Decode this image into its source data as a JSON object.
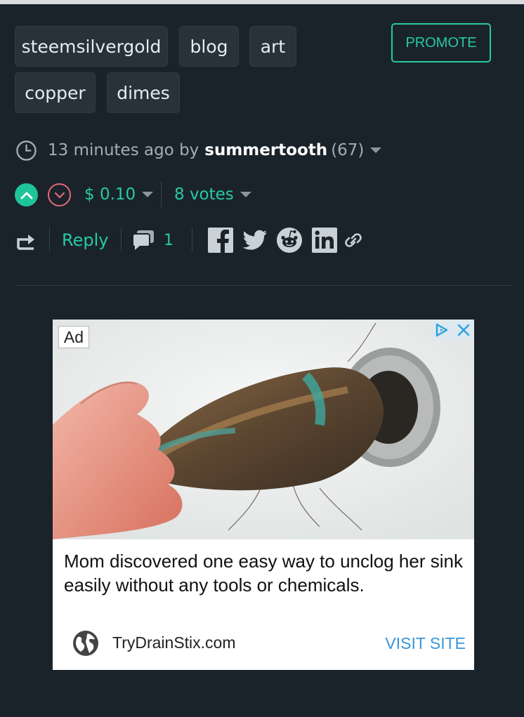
{
  "tags": [
    "steemsilvergold",
    "blog",
    "art",
    "copper",
    "dimes"
  ],
  "promote_label": "PROMOTE",
  "meta": {
    "time_ago": "13 minutes ago by",
    "author": "summertooth",
    "reputation": "(67)",
    "icon": "clock-icon"
  },
  "voting": {
    "payout": "$ 0.10",
    "votes": "8 votes",
    "upvote_icon": "upvote-icon",
    "downvote_icon": "downvote-icon",
    "upvote_color": "#1ec49a",
    "downvote_color": "#e0697a"
  },
  "actions": {
    "reply": "Reply",
    "comment_count": "1",
    "share_icons": [
      "facebook-icon",
      "twitter-icon",
      "reddit-icon",
      "linkedin-icon",
      "link-icon"
    ]
  },
  "ad": {
    "label": "Ad",
    "headline": "Mom discovered one easy way to unclog her sink easily without any tools or chemicals.",
    "domain": "TryDrainStix.com",
    "cta": "VISIT SITE",
    "cta_color": "#3a95da"
  },
  "colors": {
    "background": "#1b232a",
    "accent": "#27c9a6",
    "tag_bg": "#28323a"
  }
}
